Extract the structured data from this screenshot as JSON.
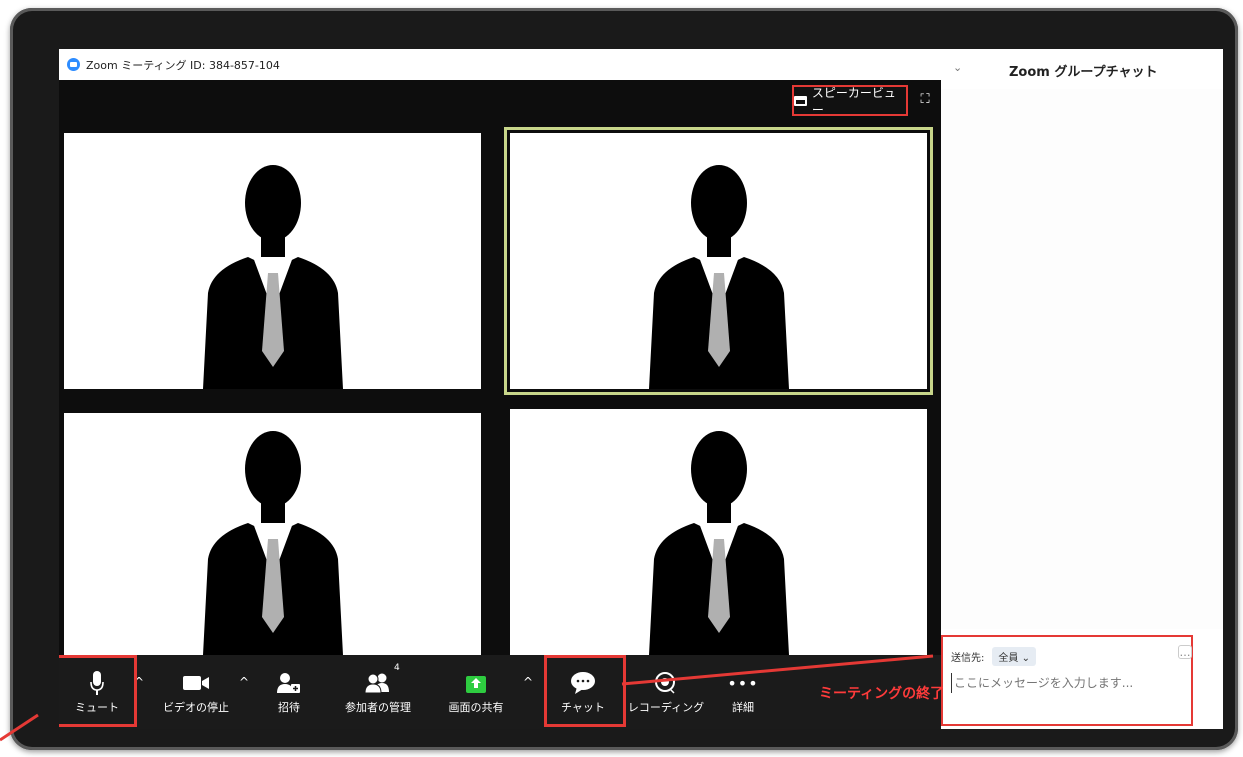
{
  "window": {
    "title": "Zoom ミーティング ID: 384-857-104"
  },
  "view": {
    "speaker_view_label": "スピーカービュー"
  },
  "chat": {
    "title": "Zoom グループチャット",
    "send_to_label": "送信先:",
    "send_to_value": "全員",
    "placeholder": "ここにメッセージを入力します..."
  },
  "toolbar": {
    "mute": "ミュート",
    "stop_video": "ビデオの停止",
    "invite": "招待",
    "participants": "参加者の管理",
    "participants_count": "4",
    "share": "画面の共有",
    "chat": "チャット",
    "record": "レコーディング",
    "more": "詳細",
    "end": "ミーティングの終了"
  },
  "colors": {
    "highlight": "#e53935",
    "share_green": "#2ecc40",
    "active_speaker": "#c8d68a",
    "zoom_blue": "#2d8cff"
  }
}
